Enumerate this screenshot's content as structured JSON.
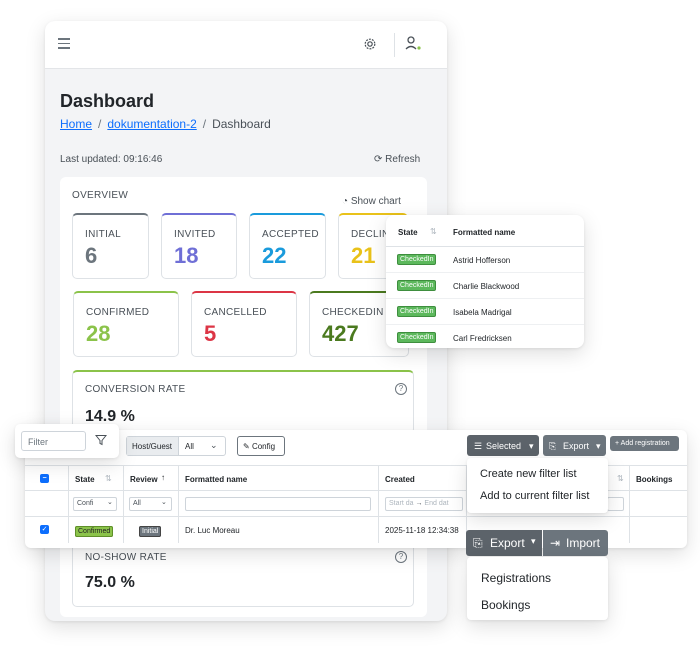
{
  "header": {
    "icons": [
      "menu-icon",
      "gear-icon",
      "user-icon"
    ]
  },
  "page": {
    "title": "Dashboard",
    "breadcrumb": [
      "Home",
      "dokumentation-2",
      "Dashboard"
    ],
    "last_updated": "Last updated: 09:16:46",
    "refresh_label": "Refresh"
  },
  "overview": {
    "title": "OVERVIEW",
    "show_chart_label": "Show chart",
    "stats": [
      {
        "label": "INITIAL",
        "value": "6",
        "color": "#6c757d"
      },
      {
        "label": "INVITED",
        "value": "18",
        "color": "#6f6fd6"
      },
      {
        "label": "ACCEPTED",
        "value": "22",
        "color": "#1a9bdc"
      },
      {
        "label": "DECLIN",
        "value": "21",
        "color": "#e9c21a"
      },
      {
        "label": "CONFIRMED",
        "value": "28",
        "color": "#8bc34a"
      },
      {
        "label": "CANCELLED",
        "value": "5",
        "color": "#dc3545"
      },
      {
        "label": "CHECKEDIN",
        "value": "427",
        "color": "#4b7a1f"
      }
    ],
    "conversion_rate": {
      "label": "CONVERSION RATE",
      "value": "14.9 %"
    },
    "no_show_rate": {
      "label": "NO-SHOW RATE",
      "value": "75.0 %"
    }
  },
  "state_table": {
    "columns": [
      "State",
      "Formatted name"
    ],
    "rows": [
      {
        "state": "CheckedIn",
        "name": "Astrid Hofferson"
      },
      {
        "state": "CheckedIn",
        "name": "Charlie Blackwood"
      },
      {
        "state": "CheckedIn",
        "name": "Isabela Madrigal"
      },
      {
        "state": "CheckedIn",
        "name": "Carl Fredricksen"
      }
    ]
  },
  "filter": {
    "placeholder": "Filter"
  },
  "registrations": {
    "host_guest_label": "Host/Guest",
    "host_guest_value": "All",
    "config_label": "Config",
    "selected_label": "Selected",
    "export_label": "Export",
    "add_registration_label": "+ Add registration",
    "columns": [
      "State",
      "Review",
      "Formatted name",
      "Created",
      "Bookings"
    ],
    "filters": {
      "state": "Confi",
      "review": "All",
      "start_date": "Start da",
      "end_date": "End dat"
    },
    "row": {
      "state": "Confirmed",
      "review": "Initial",
      "name": "Dr. Luc Moreau",
      "created": "2025-11-18 12:34:38"
    }
  },
  "selected_menu": [
    "Create new filter list",
    "Add to current filter list"
  ],
  "export_import": {
    "export_label": "Export",
    "import_label": "Import",
    "menu": [
      "Registrations",
      "Bookings"
    ]
  }
}
